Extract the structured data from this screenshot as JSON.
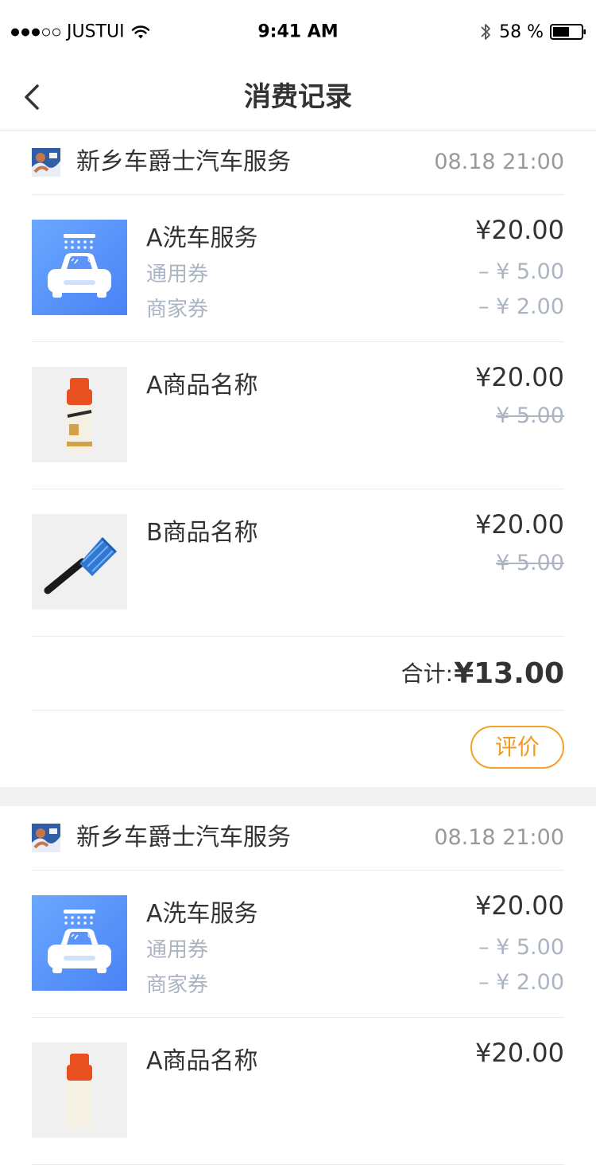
{
  "status_bar": {
    "carrier": "JUSTUI",
    "time": "9:41 AM",
    "battery": "58 %"
  },
  "nav": {
    "title": "消费记录"
  },
  "orders": [
    {
      "shop_name": "新乡车爵士汽车服务",
      "time": "08.18 21:00",
      "items": [
        {
          "name": "A洗车服务",
          "price": "¥20.00",
          "coupons": [
            {
              "label": "通用券",
              "amount": "– ¥ 5.00"
            },
            {
              "label": "商家券",
              "amount": "– ¥ 2.00"
            }
          ]
        },
        {
          "name": "A商品名称",
          "price": "¥20.00",
          "original_price": "¥ 5.00"
        },
        {
          "name": "B商品名称",
          "price": "¥20.00",
          "original_price": "¥ 5.00"
        }
      ],
      "total_label": "合计:",
      "total": "¥13.00",
      "review_label": "评价"
    },
    {
      "shop_name": "新乡车爵士汽车服务",
      "time": "08.18 21:00",
      "items": [
        {
          "name": "A洗车服务",
          "price": "¥20.00",
          "coupons": [
            {
              "label": "通用券",
              "amount": "– ¥ 5.00"
            },
            {
              "label": "商家券",
              "amount": "– ¥ 2.00"
            }
          ]
        },
        {
          "name": "A商品名称",
          "price": "¥20.00"
        }
      ]
    }
  ],
  "colors": {
    "accent": "#f29a1a",
    "muted_text": "#aab4c2",
    "divider": "#ebebeb",
    "section_gap": "#f2f2f2"
  }
}
